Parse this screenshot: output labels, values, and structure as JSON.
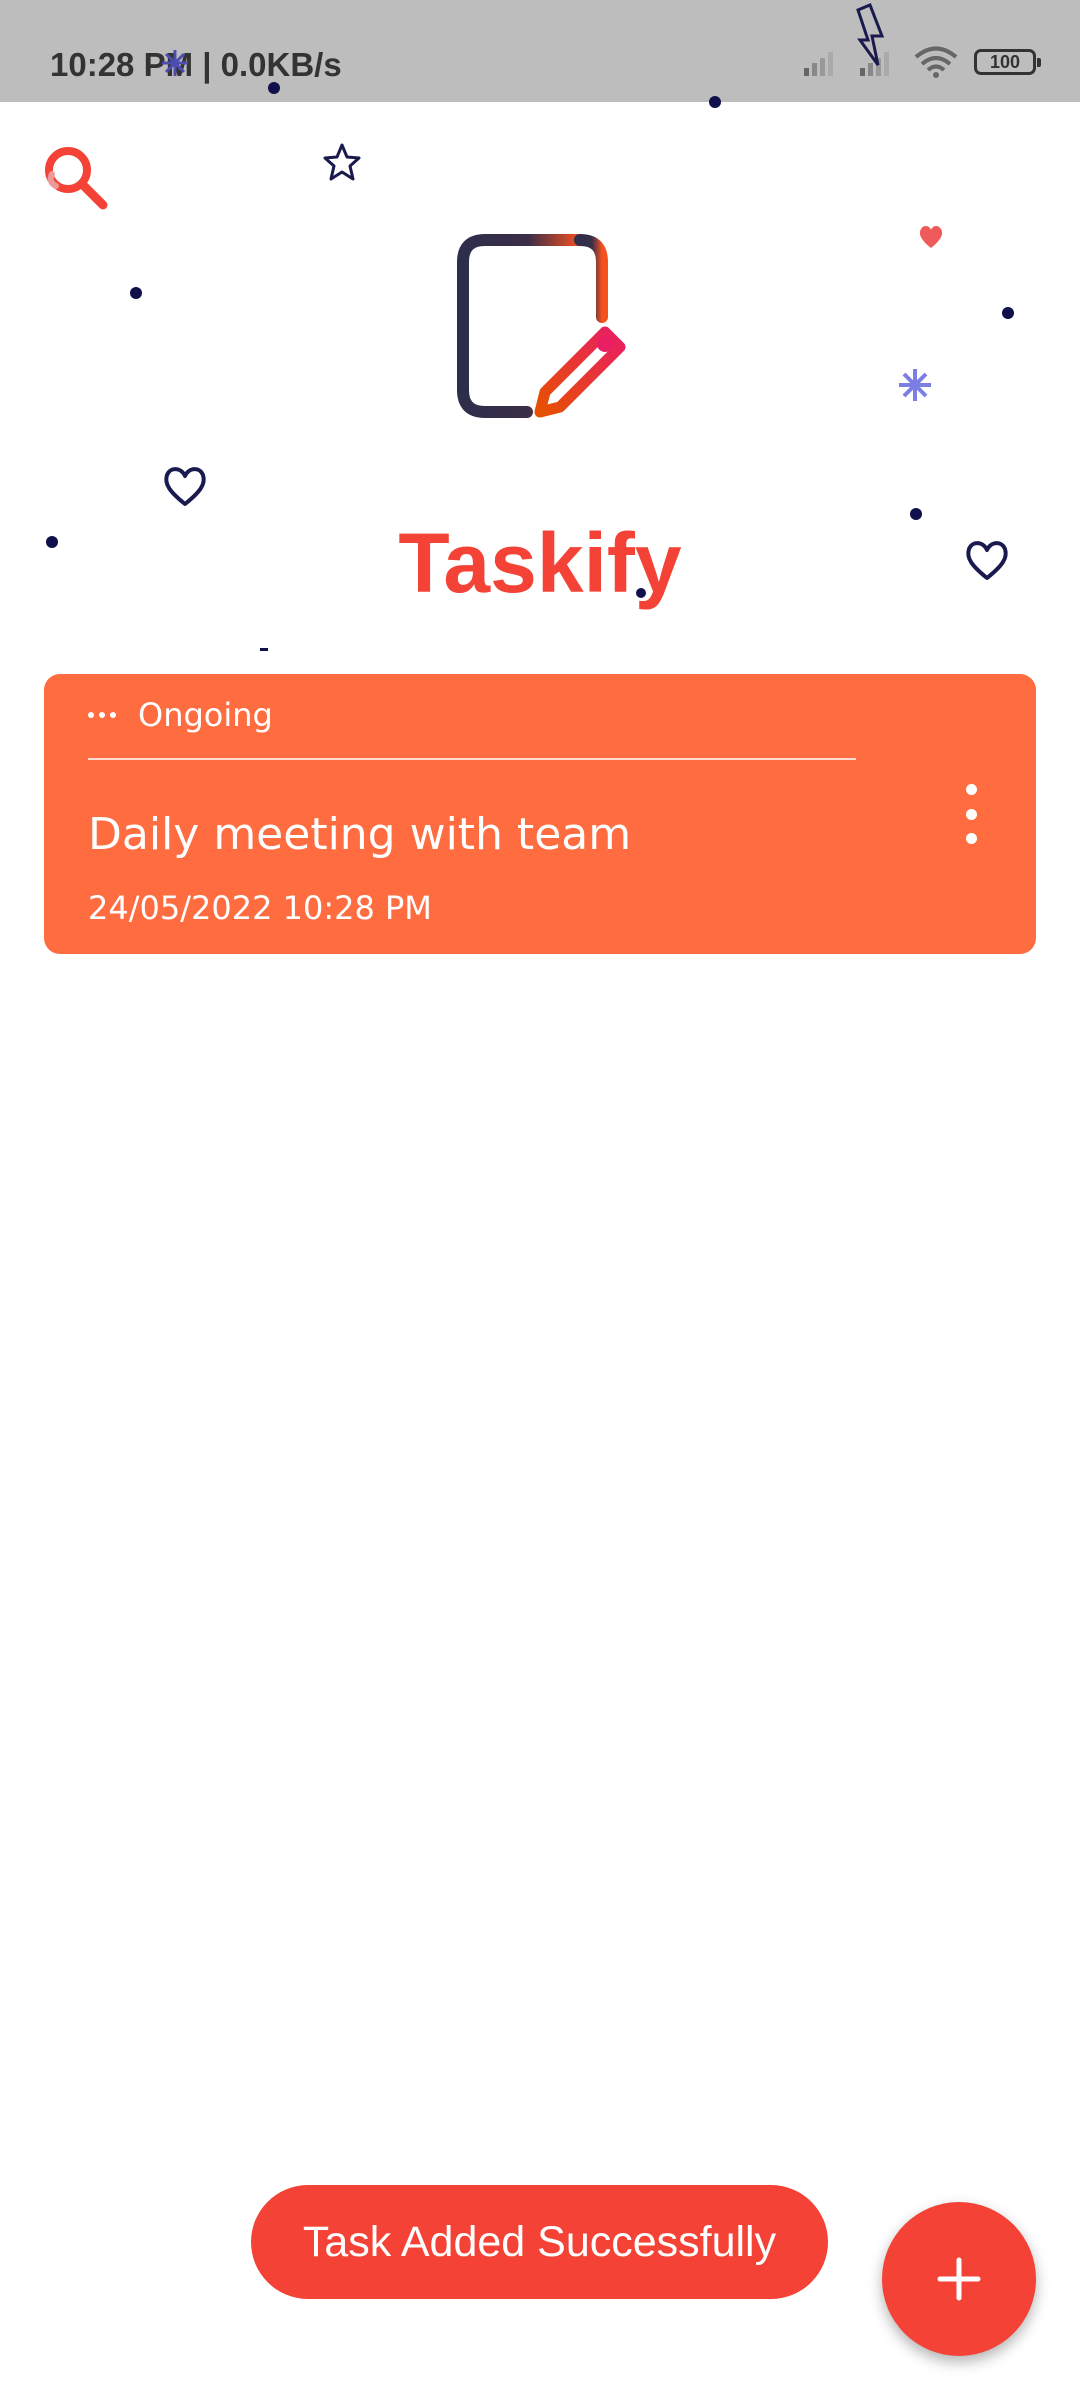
{
  "status_bar": {
    "time_speed": "10:28 PM | 0.0KB/s",
    "battery": "100"
  },
  "icons": {
    "search": "search-icon",
    "logo": "notes-pencil-logo",
    "add": "plus-icon",
    "more": "more-vert-icon"
  },
  "colors": {
    "accent": "#f44336",
    "card": "#ff6c40",
    "status_bar": "#bdbdbd"
  },
  "app": {
    "title": "Taskify"
  },
  "tasks": [
    {
      "status": "Ongoing",
      "title": "Daily meeting with team",
      "datetime": "24/05/2022 10:28 PM"
    }
  ],
  "toast": {
    "message": "Task Added Successfully"
  }
}
